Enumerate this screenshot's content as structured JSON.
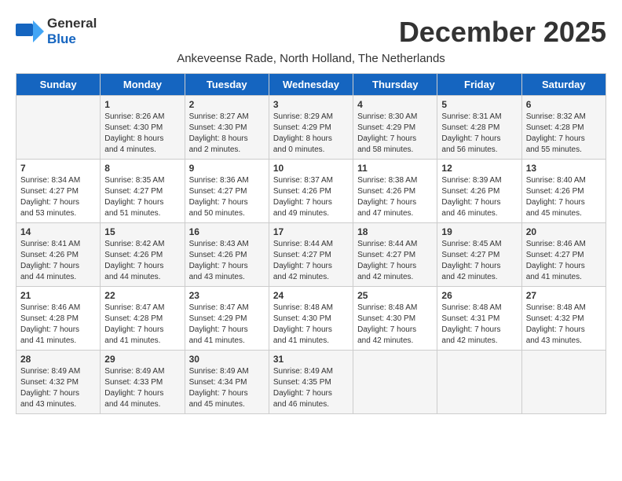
{
  "header": {
    "logo_general": "General",
    "logo_blue": "Blue",
    "month_title": "December 2025",
    "subtitle": "Ankeveense Rade, North Holland, The Netherlands"
  },
  "days_of_week": [
    "Sunday",
    "Monday",
    "Tuesday",
    "Wednesday",
    "Thursday",
    "Friday",
    "Saturday"
  ],
  "weeks": [
    [
      {
        "day": "",
        "info": ""
      },
      {
        "day": "1",
        "info": "Sunrise: 8:26 AM\nSunset: 4:30 PM\nDaylight: 8 hours\nand 4 minutes."
      },
      {
        "day": "2",
        "info": "Sunrise: 8:27 AM\nSunset: 4:30 PM\nDaylight: 8 hours\nand 2 minutes."
      },
      {
        "day": "3",
        "info": "Sunrise: 8:29 AM\nSunset: 4:29 PM\nDaylight: 8 hours\nand 0 minutes."
      },
      {
        "day": "4",
        "info": "Sunrise: 8:30 AM\nSunset: 4:29 PM\nDaylight: 7 hours\nand 58 minutes."
      },
      {
        "day": "5",
        "info": "Sunrise: 8:31 AM\nSunset: 4:28 PM\nDaylight: 7 hours\nand 56 minutes."
      },
      {
        "day": "6",
        "info": "Sunrise: 8:32 AM\nSunset: 4:28 PM\nDaylight: 7 hours\nand 55 minutes."
      }
    ],
    [
      {
        "day": "7",
        "info": "Sunrise: 8:34 AM\nSunset: 4:27 PM\nDaylight: 7 hours\nand 53 minutes."
      },
      {
        "day": "8",
        "info": "Sunrise: 8:35 AM\nSunset: 4:27 PM\nDaylight: 7 hours\nand 51 minutes."
      },
      {
        "day": "9",
        "info": "Sunrise: 8:36 AM\nSunset: 4:27 PM\nDaylight: 7 hours\nand 50 minutes."
      },
      {
        "day": "10",
        "info": "Sunrise: 8:37 AM\nSunset: 4:26 PM\nDaylight: 7 hours\nand 49 minutes."
      },
      {
        "day": "11",
        "info": "Sunrise: 8:38 AM\nSunset: 4:26 PM\nDaylight: 7 hours\nand 47 minutes."
      },
      {
        "day": "12",
        "info": "Sunrise: 8:39 AM\nSunset: 4:26 PM\nDaylight: 7 hours\nand 46 minutes."
      },
      {
        "day": "13",
        "info": "Sunrise: 8:40 AM\nSunset: 4:26 PM\nDaylight: 7 hours\nand 45 minutes."
      }
    ],
    [
      {
        "day": "14",
        "info": "Sunrise: 8:41 AM\nSunset: 4:26 PM\nDaylight: 7 hours\nand 44 minutes."
      },
      {
        "day": "15",
        "info": "Sunrise: 8:42 AM\nSunset: 4:26 PM\nDaylight: 7 hours\nand 44 minutes."
      },
      {
        "day": "16",
        "info": "Sunrise: 8:43 AM\nSunset: 4:26 PM\nDaylight: 7 hours\nand 43 minutes."
      },
      {
        "day": "17",
        "info": "Sunrise: 8:44 AM\nSunset: 4:27 PM\nDaylight: 7 hours\nand 42 minutes."
      },
      {
        "day": "18",
        "info": "Sunrise: 8:44 AM\nSunset: 4:27 PM\nDaylight: 7 hours\nand 42 minutes."
      },
      {
        "day": "19",
        "info": "Sunrise: 8:45 AM\nSunset: 4:27 PM\nDaylight: 7 hours\nand 42 minutes."
      },
      {
        "day": "20",
        "info": "Sunrise: 8:46 AM\nSunset: 4:27 PM\nDaylight: 7 hours\nand 41 minutes."
      }
    ],
    [
      {
        "day": "21",
        "info": "Sunrise: 8:46 AM\nSunset: 4:28 PM\nDaylight: 7 hours\nand 41 minutes."
      },
      {
        "day": "22",
        "info": "Sunrise: 8:47 AM\nSunset: 4:28 PM\nDaylight: 7 hours\nand 41 minutes."
      },
      {
        "day": "23",
        "info": "Sunrise: 8:47 AM\nSunset: 4:29 PM\nDaylight: 7 hours\nand 41 minutes."
      },
      {
        "day": "24",
        "info": "Sunrise: 8:48 AM\nSunset: 4:30 PM\nDaylight: 7 hours\nand 41 minutes."
      },
      {
        "day": "25",
        "info": "Sunrise: 8:48 AM\nSunset: 4:30 PM\nDaylight: 7 hours\nand 42 minutes."
      },
      {
        "day": "26",
        "info": "Sunrise: 8:48 AM\nSunset: 4:31 PM\nDaylight: 7 hours\nand 42 minutes."
      },
      {
        "day": "27",
        "info": "Sunrise: 8:48 AM\nSunset: 4:32 PM\nDaylight: 7 hours\nand 43 minutes."
      }
    ],
    [
      {
        "day": "28",
        "info": "Sunrise: 8:49 AM\nSunset: 4:32 PM\nDaylight: 7 hours\nand 43 minutes."
      },
      {
        "day": "29",
        "info": "Sunrise: 8:49 AM\nSunset: 4:33 PM\nDaylight: 7 hours\nand 44 minutes."
      },
      {
        "day": "30",
        "info": "Sunrise: 8:49 AM\nSunset: 4:34 PM\nDaylight: 7 hours\nand 45 minutes."
      },
      {
        "day": "31",
        "info": "Sunrise: 8:49 AM\nSunset: 4:35 PM\nDaylight: 7 hours\nand 46 minutes."
      },
      {
        "day": "",
        "info": ""
      },
      {
        "day": "",
        "info": ""
      },
      {
        "day": "",
        "info": ""
      }
    ]
  ]
}
